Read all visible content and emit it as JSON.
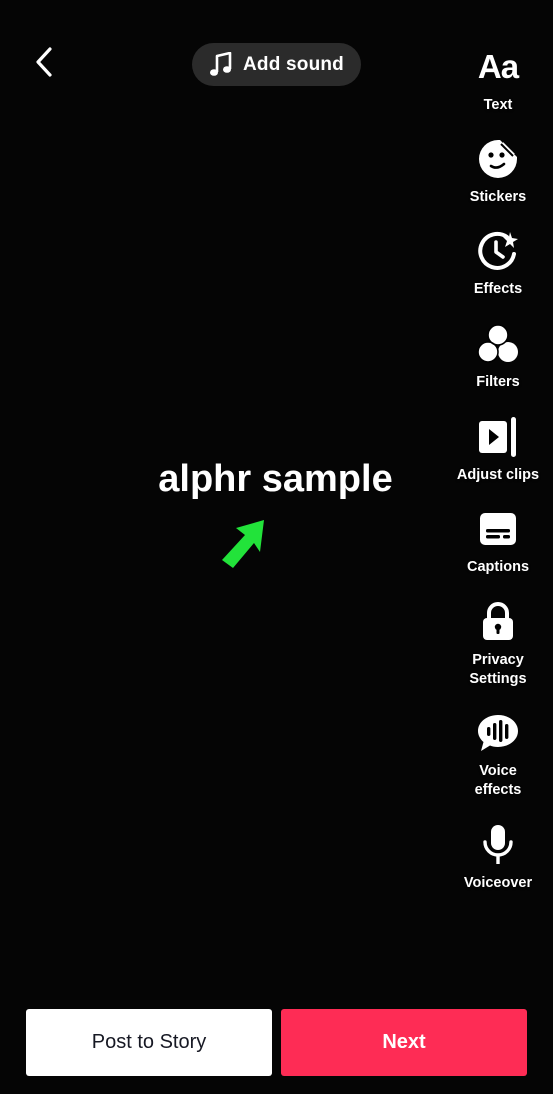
{
  "header": {
    "back_icon": "chevron-left-icon",
    "add_sound": {
      "icon": "music-note-icon",
      "label": "Add sound"
    }
  },
  "toolbar": {
    "items": [
      {
        "label": "Text",
        "icon": "text-aa-icon",
        "icon_text": "Aa"
      },
      {
        "label": "Stickers",
        "icon": "sticker-icon"
      },
      {
        "label": "Effects",
        "icon": "effects-clock-icon"
      },
      {
        "label": "Filters",
        "icon": "filters-icon"
      },
      {
        "label": "Adjust clips",
        "icon": "adjust-clips-icon"
      },
      {
        "label": "Captions",
        "icon": "captions-icon"
      },
      {
        "label": "Privacy\nSettings",
        "icon": "lock-icon"
      },
      {
        "label": "Voice\neffects",
        "icon": "voice-effects-icon"
      },
      {
        "label": "Voiceover",
        "icon": "microphone-icon"
      }
    ]
  },
  "canvas": {
    "overlay_text": "alphr sample",
    "pointer_icon": "green-arrow-icon",
    "pointer_color": "#22e33a"
  },
  "footer": {
    "post_to_story_label": "Post to Story",
    "next_label": "Next"
  },
  "colors": {
    "background": "#050505",
    "accent": "#fe2c55",
    "pill": "#2b2b2b"
  }
}
